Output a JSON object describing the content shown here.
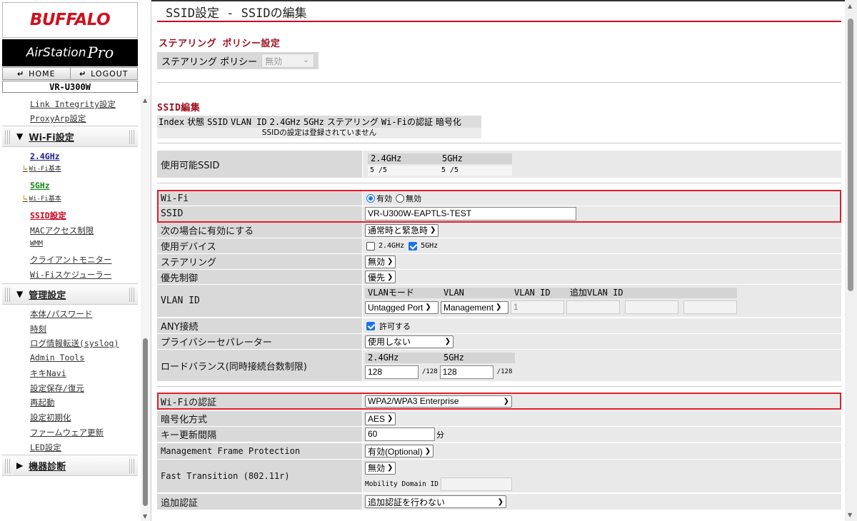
{
  "sidebar": {
    "logo": "BUFFALO",
    "product_name": "AirStation",
    "product_suffix": "Pro",
    "home_label": "HOME",
    "logout_label": "LOGOUT",
    "model": "VR-U300W",
    "links_top": [
      "Link Integrity設定",
      "ProxyArp設定"
    ],
    "wifi_section": "Wi-Fi設定",
    "band24": "2.4GHz",
    "band24_basic": "Wi-Fi基本",
    "band5": "5GHz",
    "band5_basic": "Wi-Fi基本",
    "wifi_links": [
      "SSID設定",
      "MACアクセス制限",
      "WMM",
      "クライアントモニター",
      "Wi-Fiスケジューラー"
    ],
    "admin_section": "管理設定",
    "admin_links": [
      "本体/パスワード",
      "時刻",
      "ログ情報転送(syslog)",
      "Admin Tools",
      "キキNavi",
      "設定保存/復元",
      "再起動",
      "設定初期化",
      "ファームウェア更新",
      "LED設定"
    ],
    "diag_section": "機器診断"
  },
  "main": {
    "title": "SSID設定 - SSIDの編集",
    "steering": {
      "heading": "ステアリング ポリシー設定",
      "label": "ステアリング ポリシー",
      "value": "無効"
    },
    "ssid_edit": {
      "heading": "SSID編集",
      "columns": [
        "Index",
        "状態",
        "SSID",
        "VLAN ID",
        "2.4GHz",
        "5GHz",
        "ステアリング",
        "Wi-Fiの認証",
        "暗号化"
      ],
      "empty_message": "SSIDの設定は登録されていません"
    },
    "available": {
      "label": "使用可能SSID",
      "band24": "2.4GHz",
      "band5": "5GHz",
      "val24": "5 /5",
      "val5": "5 /5"
    },
    "form": {
      "wifi_label": "Wi-Fi",
      "wifi_on": "有効",
      "wifi_off": "無効",
      "ssid_label": "SSID",
      "ssid_value": "VR-U300W-EAPTLS-TEST",
      "enable_when_label": "次の場合に有効にする",
      "enable_when_value": "通常時と緊急時",
      "devices_label": "使用デバイス",
      "device24": "2.4GHz",
      "device5": "5GHz",
      "steering_label": "ステアリング",
      "steering_value": "無効",
      "priority_label": "優先制御",
      "priority_value": "優先",
      "vlan_label": "VLAN ID",
      "vlan_headers": [
        "VLANモード",
        "VLAN",
        "VLAN ID",
        "追加VLAN ID"
      ],
      "vlan_mode": "Untagged Port",
      "vlan_name": "Management",
      "vlan_id": "1",
      "any_label": "ANY接続",
      "any_value": "許可する",
      "privacy_label": "プライバシーセパレーター",
      "privacy_value": "使用しない",
      "lb_label": "ロードバランス(同時接続台数制限)",
      "lb_band24": "2.4GHz",
      "lb_band5": "5GHz",
      "lb_val24": "128",
      "lb_val5": "128",
      "lb_max24": "/128",
      "lb_max5": "/128",
      "auth_label": "Wi-Fiの認証",
      "auth_value": "WPA2/WPA3 Enterprise",
      "enc_label": "暗号化方式",
      "enc_value": "AES",
      "rekey_label": "キー更新間隔",
      "rekey_value": "60",
      "rekey_unit": "分",
      "mfp_label": "Management Frame Protection",
      "mfp_value": "有効(Optional)",
      "ft_label": "Fast Transition (802.11r)",
      "ft_value": "無効",
      "mdid_label": "Mobility Domain ID",
      "addauth_label": "追加認証",
      "addauth_value": "追加認証を行わない"
    }
  },
  "colors": {
    "accent_red": "#c8001a",
    "highlight_box": "#e01e2a",
    "checkbox_blue": "#1a73e8"
  }
}
